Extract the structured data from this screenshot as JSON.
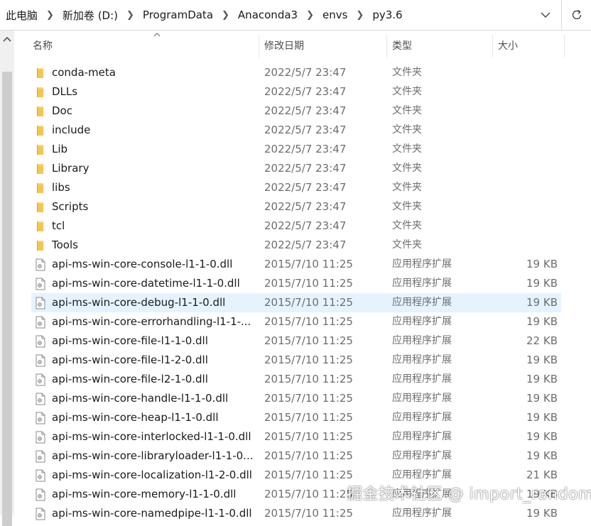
{
  "breadcrumb": [
    "此电脑",
    "新加卷 (D:)",
    "ProgramData",
    "Anaconda3",
    "envs",
    "py3.6"
  ],
  "columns": {
    "name": "名称",
    "date": "修改日期",
    "type": "类型",
    "size": "大小"
  },
  "items": [
    {
      "name": "conda-meta",
      "date": "2022/5/7 23:47",
      "type": "文件夹",
      "size": "",
      "kind": "folder"
    },
    {
      "name": "DLLs",
      "date": "2022/5/7 23:47",
      "type": "文件夹",
      "size": "",
      "kind": "folder"
    },
    {
      "name": "Doc",
      "date": "2022/5/7 23:47",
      "type": "文件夹",
      "size": "",
      "kind": "folder"
    },
    {
      "name": "include",
      "date": "2022/5/7 23:47",
      "type": "文件夹",
      "size": "",
      "kind": "folder"
    },
    {
      "name": "Lib",
      "date": "2022/5/7 23:47",
      "type": "文件夹",
      "size": "",
      "kind": "folder"
    },
    {
      "name": "Library",
      "date": "2022/5/7 23:47",
      "type": "文件夹",
      "size": "",
      "kind": "folder"
    },
    {
      "name": "libs",
      "date": "2022/5/7 23:47",
      "type": "文件夹",
      "size": "",
      "kind": "folder"
    },
    {
      "name": "Scripts",
      "date": "2022/5/7 23:47",
      "type": "文件夹",
      "size": "",
      "kind": "folder"
    },
    {
      "name": "tcl",
      "date": "2022/5/7 23:47",
      "type": "文件夹",
      "size": "",
      "kind": "folder"
    },
    {
      "name": "Tools",
      "date": "2022/5/7 23:47",
      "type": "文件夹",
      "size": "",
      "kind": "folder"
    },
    {
      "name": "api-ms-win-core-console-l1-1-0.dll",
      "date": "2015/7/10 11:25",
      "type": "应用程序扩展",
      "size": "19 KB",
      "kind": "file"
    },
    {
      "name": "api-ms-win-core-datetime-l1-1-0.dll",
      "date": "2015/7/10 11:25",
      "type": "应用程序扩展",
      "size": "19 KB",
      "kind": "file"
    },
    {
      "name": "api-ms-win-core-debug-l1-1-0.dll",
      "date": "2015/7/10 11:25",
      "type": "应用程序扩展",
      "size": "19 KB",
      "kind": "file",
      "selected": true
    },
    {
      "name": "api-ms-win-core-errorhandling-l1-1-...",
      "date": "2015/7/10 11:25",
      "type": "应用程序扩展",
      "size": "19 KB",
      "kind": "file"
    },
    {
      "name": "api-ms-win-core-file-l1-1-0.dll",
      "date": "2015/7/10 11:25",
      "type": "应用程序扩展",
      "size": "22 KB",
      "kind": "file"
    },
    {
      "name": "api-ms-win-core-file-l1-2-0.dll",
      "date": "2015/7/10 11:25",
      "type": "应用程序扩展",
      "size": "19 KB",
      "kind": "file"
    },
    {
      "name": "api-ms-win-core-file-l2-1-0.dll",
      "date": "2015/7/10 11:25",
      "type": "应用程序扩展",
      "size": "19 KB",
      "kind": "file"
    },
    {
      "name": "api-ms-win-core-handle-l1-1-0.dll",
      "date": "2015/7/10 11:25",
      "type": "应用程序扩展",
      "size": "19 KB",
      "kind": "file"
    },
    {
      "name": "api-ms-win-core-heap-l1-1-0.dll",
      "date": "2015/7/10 11:25",
      "type": "应用程序扩展",
      "size": "19 KB",
      "kind": "file"
    },
    {
      "name": "api-ms-win-core-interlocked-l1-1-0.dll",
      "date": "2015/7/10 11:25",
      "type": "应用程序扩展",
      "size": "19 KB",
      "kind": "file"
    },
    {
      "name": "api-ms-win-core-libraryloader-l1-1-0...",
      "date": "2015/7/10 11:25",
      "type": "应用程序扩展",
      "size": "19 KB",
      "kind": "file"
    },
    {
      "name": "api-ms-win-core-localization-l1-2-0.dll",
      "date": "2015/7/10 11:25",
      "type": "应用程序扩展",
      "size": "21 KB",
      "kind": "file"
    },
    {
      "name": "api-ms-win-core-memory-l1-1-0.dll",
      "date": "2015/7/10 11:25",
      "type": "应用程序扩展",
      "size": "19 KB",
      "kind": "file"
    },
    {
      "name": "api-ms-win-core-namedpipe-l1-1-0.dll",
      "date": "2015/7/10 11:25",
      "type": "应用程序扩展",
      "size": "19 KB",
      "kind": "file"
    }
  ],
  "watermark": "掘金技术社区 @ import_random",
  "colors": {
    "selection": "#e5f3ff",
    "folder": "#f4c650",
    "muted_text": "#6d6d6d"
  },
  "icons": {
    "dropdown": "chevron-down-icon",
    "refresh": "refresh-icon",
    "folder": "folder-icon",
    "file": "dll-file-icon",
    "sort": "sort-up-icon",
    "scroll_up": "scroll-up-icon"
  }
}
